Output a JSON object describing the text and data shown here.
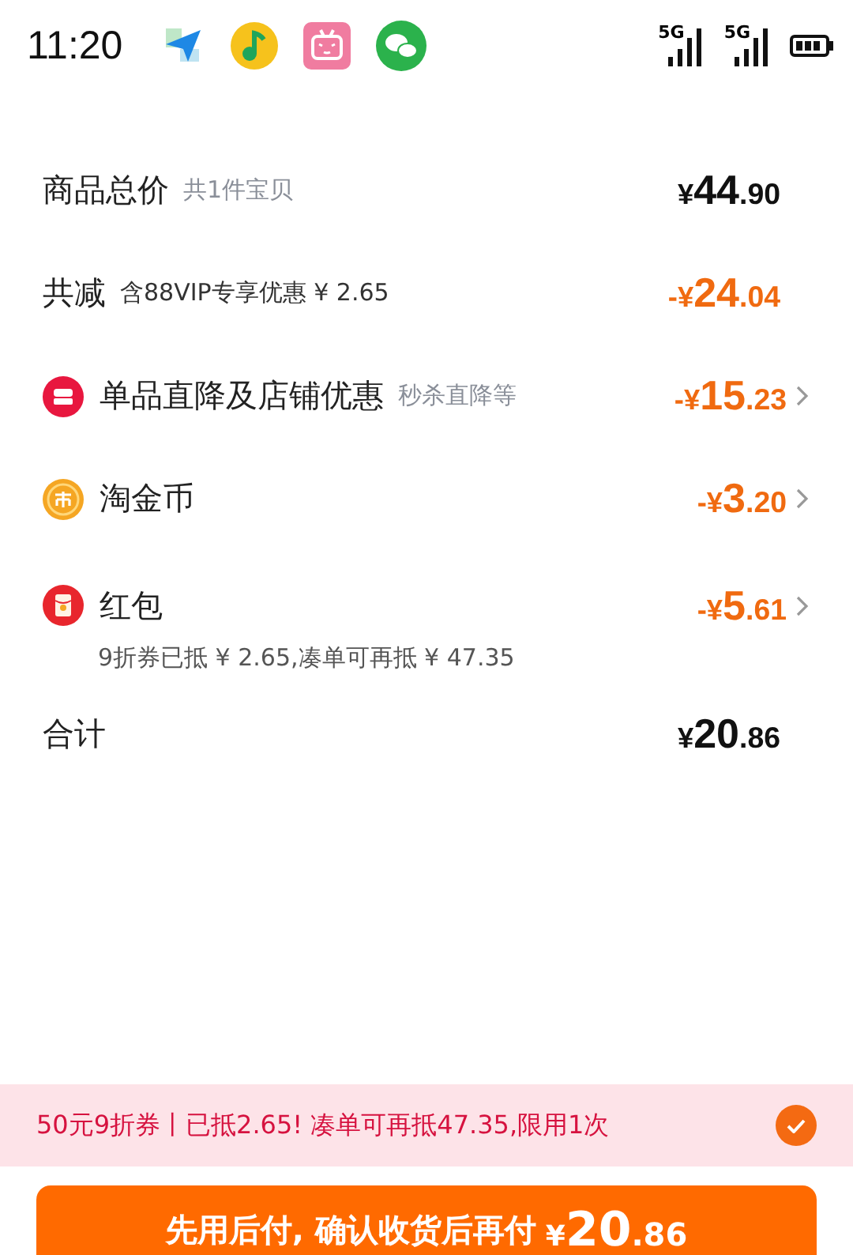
{
  "status_bar": {
    "time": "11:20",
    "apps": [
      {
        "kind": "send"
      },
      {
        "kind": "music"
      },
      {
        "kind": "tv"
      },
      {
        "kind": "chat"
      }
    ],
    "signals": [
      {
        "label": "5G"
      },
      {
        "label": "5G"
      }
    ]
  },
  "rows": [
    {
      "kind": "plain",
      "label": "商品总价",
      "note": "共1件宝贝",
      "price": {
        "kind": "normal",
        "currency": "¥",
        "integer": "44",
        "decimal": ".90"
      },
      "chevron": false
    },
    {
      "kind": "plain",
      "label": "共减",
      "note": "含88VIP专享优惠 ¥ 2.65",
      "price": {
        "kind": "discount",
        "currency": "-¥",
        "integer": "24",
        "decimal": ".04"
      },
      "chevron": false
    },
    {
      "kind": "shop",
      "label": "单品直降及店铺优惠",
      "note": "秒杀直降等",
      "price": {
        "kind": "discount",
        "currency": "-¥",
        "integer": "15",
        "decimal": ".23"
      },
      "chevron": true
    },
    {
      "kind": "coin",
      "label": "淘金币",
      "price": {
        "kind": "discount",
        "currency": "-¥",
        "integer": "3",
        "decimal": ".20"
      },
      "chevron": true
    },
    {
      "kind": "packet",
      "label": "红包",
      "detail": "9折券已抵 ¥ 2.65,凑单可再抵 ¥ 47.35",
      "price": {
        "kind": "discount",
        "currency": "-¥",
        "integer": "5",
        "decimal": ".61"
      },
      "chevron": true
    },
    {
      "kind": "plain",
      "label": "合计",
      "price": {
        "kind": "normal",
        "currency": "¥",
        "integer": "20",
        "decimal": ".86"
      },
      "chevron": false
    }
  ],
  "coupon": {
    "text": "50元9折券丨已抵2.65! 凑单可再抵47.35,限用1次",
    "checked": true
  },
  "pay_button": {
    "label": "先用后付, 确认收货后再付",
    "currency": "¥",
    "integer": "20",
    "decimal": ".86"
  }
}
